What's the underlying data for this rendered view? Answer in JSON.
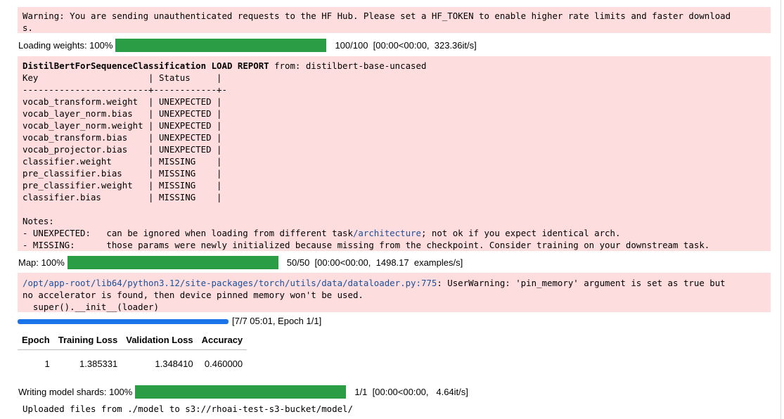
{
  "warning_box": {
    "text": "Warning: You are sending unauthenticated requests to the HF Hub. Please set a HF_TOKEN to enable higher rate limits and faster download\ns."
  },
  "loading_weights": {
    "label": "Loading weights: 100%",
    "progress_fraction": 1.0,
    "status": "100/100  [00:00<00:00,  323.36it/s]"
  },
  "load_report": {
    "model_name": "DistilBertForSequenceClassification",
    "title_rest": "LOAD REPORT",
    "from_text": " from: distilbert-base-uncased",
    "table_text": "Key                     | Status     |\n------------------------+------------+-\nvocab_transform.weight  | UNEXPECTED |\nvocab_layer_norm.bias   | UNEXPECTED |\nvocab_layer_norm.weight | UNEXPECTED |\nvocab_transform.bias    | UNEXPECTED |\nvocab_projector.bias    | UNEXPECTED |\nclassifier.weight       | MISSING    |\npre_classifier.bias     | MISSING    |\npre_classifier.weight   | MISSING    |\nclassifier.bias         | MISSING    |\n\nNotes:",
    "note_unexpected_pre": "- UNEXPECTED:   can be ignored when loading from different task",
    "note_unexpected_link": "/architecture",
    "note_unexpected_post": "; not ok if you expect identical arch.",
    "note_missing": "- MISSING:      those params were newly initialized because missing from the checkpoint. Consider training on your downstream task."
  },
  "map_progress": {
    "label": "Map: 100%",
    "progress_fraction": 1.0,
    "status": "50/50  [00:00<00:00,  1498.17  examples/s]"
  },
  "user_warning": {
    "path_link": "/opt/app-root/lib64/python3.12/site-packages/torch/utils/data/dataloader.py:775",
    "message": ": UserWarning: 'pin_memory' argument is set as true but\nno accelerator is found, then device pinned memory won't be used.\n  super().__init__(loader)"
  },
  "trainer": {
    "progress_fraction": 1.0,
    "status": "[7/7 05:01, Epoch 1/1]",
    "columns": [
      "Epoch",
      "Training Loss",
      "Validation Loss",
      "Accuracy"
    ],
    "rows": [
      [
        "1",
        "1.385331",
        "1.348410",
        "0.460000"
      ]
    ]
  },
  "writing_shards": {
    "label": "Writing model shards: 100%",
    "progress_fraction": 1.0,
    "status": "1/1  [00:00<00:00,   4.64it/s]"
  },
  "upload_message": "Uploaded files from ./model to s3://rhoai-test-s3-bucket/model/",
  "colors": {
    "stderr_background": "#fddddd",
    "progress_green": "#2a9d45",
    "trainer_blue": "#1a73e8",
    "link_blue": "#1a4f9c"
  }
}
